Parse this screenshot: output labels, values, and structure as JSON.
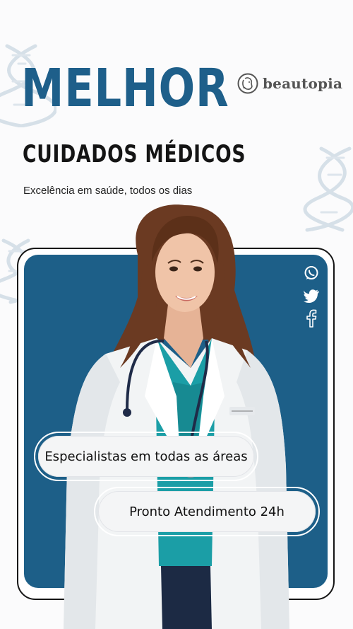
{
  "header": {
    "headline": "MELHOR",
    "subheadline": "CUIDADOS MÉDICOS",
    "tagline": "Excelência em saúde, todos os dias"
  },
  "brand": {
    "name": "beautopia",
    "icon": "face-logo-icon"
  },
  "social": [
    {
      "icon": "whatsapp-icon"
    },
    {
      "icon": "twitter-icon"
    },
    {
      "icon": "facebook-icon"
    }
  ],
  "badges": [
    {
      "label": "Especialistas em todas as áreas"
    },
    {
      "label": "Pronto Atendimento 24h"
    }
  ],
  "colors": {
    "primary": "#1d5f88",
    "headline": "#1e5f8a",
    "background": "#fbfbfc",
    "text": "#141414"
  }
}
